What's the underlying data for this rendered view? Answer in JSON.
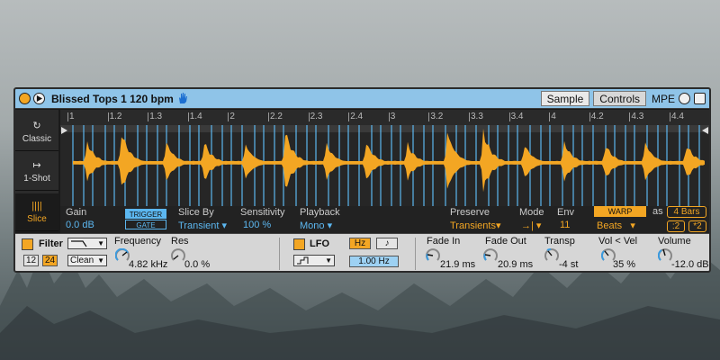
{
  "device": {
    "title": "Blissed Tops 1 120 bpm",
    "tabs": [
      {
        "label": "Sample",
        "active": true
      },
      {
        "label": "Controls",
        "active": false
      }
    ],
    "mpe_label": "MPE"
  },
  "modes": [
    {
      "label": "Classic",
      "icon": "loop-icon",
      "icon_glyph": "↻",
      "selected": false
    },
    {
      "label": "1-Shot",
      "icon": "one-shot-icon",
      "icon_glyph": "↦",
      "selected": false
    },
    {
      "label": "Slice",
      "icon": "slice-icon",
      "icon_glyph": "||||",
      "selected": true
    }
  ],
  "ruler": [
    "1",
    "1.2",
    "1.3",
    "1.4",
    "2",
    "2.2",
    "2.3",
    "2.4",
    "3",
    "3.2",
    "3.3",
    "3.4",
    "4",
    "4.2",
    "4.3",
    "4.4"
  ],
  "slice_params": {
    "gain": {
      "label": "Gain",
      "value": "0.0 dB"
    },
    "trigger_label": "TRIGGER",
    "gate_label": "GATE",
    "slice_by": {
      "label": "Slice By",
      "value": "Transient"
    },
    "sensitivity": {
      "label": "Sensitivity",
      "value": "100 %"
    },
    "playback": {
      "label": "Playback",
      "value": "Mono"
    },
    "preserve": {
      "label": "Preserve",
      "value": "Transients"
    },
    "mode": {
      "label": "Mode",
      "value": "→|"
    },
    "env": {
      "label": "Env",
      "value": "11"
    },
    "warp_label": "WARP",
    "warp_mode": "Beats",
    "as_label": "as",
    "bars": "4 Bars",
    "half": ":2",
    "double": "*2"
  },
  "filter": {
    "label": "Filter",
    "enabled": true,
    "slope_12": "12",
    "slope_24": "24",
    "type": "Clean",
    "frequency_label": "Frequency",
    "frequency_value": "4.82 kHz",
    "res_label": "Res",
    "res_value": "0.0 %"
  },
  "lfo": {
    "label": "LFO",
    "enabled": true,
    "hz_label": "Hz",
    "note_label": "♪",
    "rate_value": "1.00 Hz"
  },
  "envelope": {
    "fade_in": {
      "label": "Fade In",
      "value": "21.9 ms"
    },
    "fade_out": {
      "label": "Fade Out",
      "value": "20.9 ms"
    },
    "transp": {
      "label": "Transp",
      "value": "-4 st"
    },
    "vol_vel": {
      "label": "Vol < Vel",
      "value": "35 %"
    },
    "volume": {
      "label": "Volume",
      "value": "-12.0 dB"
    }
  },
  "colors": {
    "accent": "#f3a623",
    "blue": "#5cb7f0",
    "titlebar": "#8fc4e8"
  }
}
